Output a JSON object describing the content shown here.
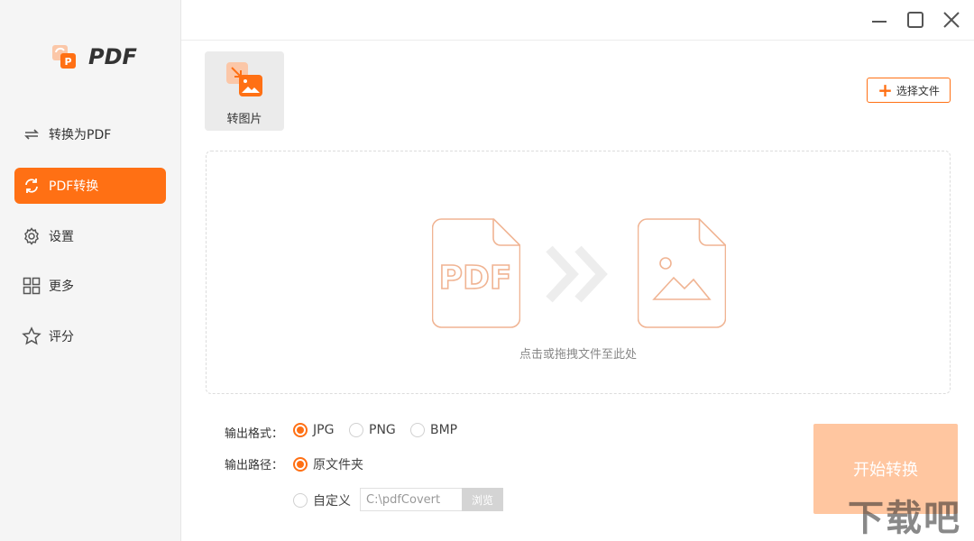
{
  "app": {
    "logo_text": "PDF"
  },
  "sidebar": {
    "items": [
      {
        "label": "转换为PDF",
        "icon": "convert-arrows-icon",
        "active": false
      },
      {
        "label": "PDF转换",
        "icon": "refresh-icon",
        "active": true
      },
      {
        "label": "设置",
        "icon": "gear-icon",
        "active": false
      },
      {
        "label": "更多",
        "icon": "grid-icon",
        "active": false
      },
      {
        "label": "评分",
        "icon": "star-icon",
        "active": false
      }
    ]
  },
  "toolbar": {
    "tab_label": "转图片",
    "select_file_label": "选择文件"
  },
  "drop_zone": {
    "pdf_text": "PDF",
    "hint": "点击或拖拽文件至此处"
  },
  "options": {
    "format_label": "输出格式：",
    "formats": [
      "JPG",
      "PNG",
      "BMP"
    ],
    "selected_format": "JPG",
    "path_label": "输出路径：",
    "path_original": "原文件夹",
    "path_custom": "自定义",
    "path_value": "C:\\pdfCovert",
    "browse_label": "浏览",
    "selected_path": "原文件夹"
  },
  "start_button": "开始转换",
  "watermark": "下载吧",
  "colors": {
    "accent": "#ff7014",
    "accent_light": "#ffc6a0",
    "icon_outline": "#f0b493"
  }
}
